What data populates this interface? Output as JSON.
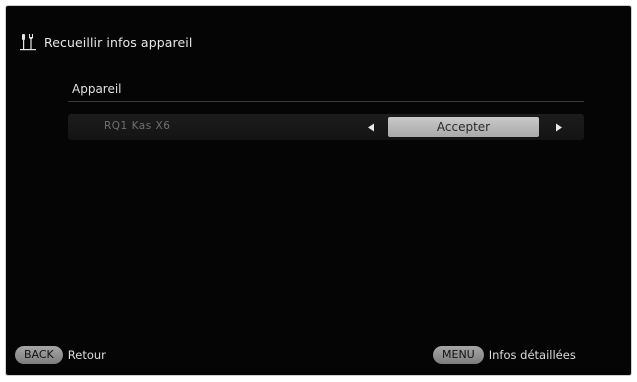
{
  "header": {
    "icon": "tools-icon",
    "title": "Recueillir infos appareil"
  },
  "section": {
    "label": "Appareil"
  },
  "device_row": {
    "name": "RQ1 Kas X6",
    "left_arrow_icon": "triangle-left-icon",
    "right_arrow_icon": "triangle-right-icon",
    "action_label": "Accepter"
  },
  "footer": {
    "back_key": "BACK",
    "back_label": "Retour",
    "menu_key": "MENU",
    "menu_label": "Infos détaillées"
  },
  "colors": {
    "screen_background": "#050505",
    "highlight_pill": "#bdbdbd",
    "text": "#e0e0e0"
  }
}
